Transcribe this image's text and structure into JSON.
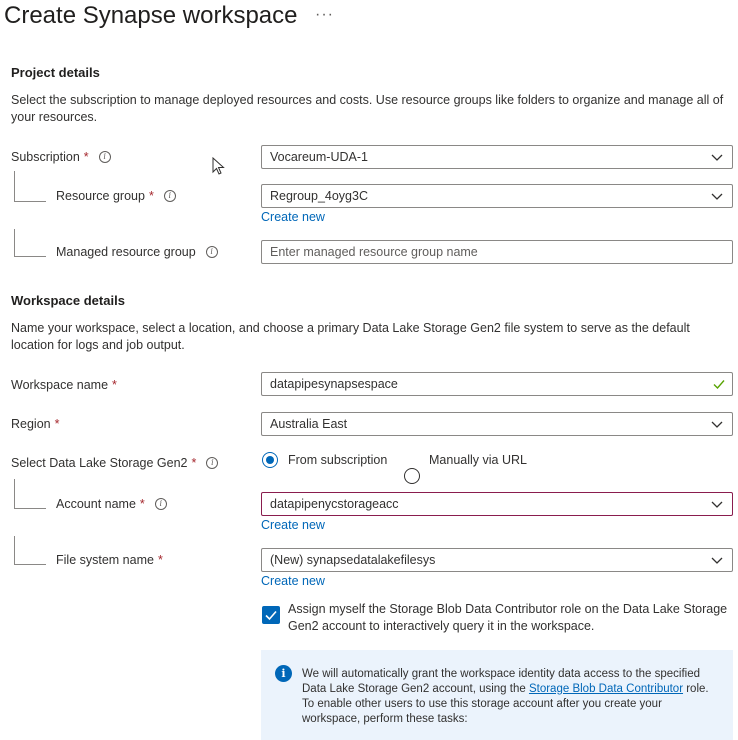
{
  "page": {
    "title": "Create Synapse workspace",
    "more_icon": "ellipsis-icon"
  },
  "project": {
    "heading": "Project details",
    "description": "Select the subscription to manage deployed resources and costs. Use resource groups like folders to organize and manage all of your resources.",
    "subscription": {
      "label": "Subscription",
      "value": "Vocareum-UDA-1"
    },
    "resource_group": {
      "label": "Resource group",
      "value": "Regroup_4oyg3C",
      "create_new": "Create new"
    },
    "managed_rg": {
      "label": "Managed resource group",
      "placeholder": "Enter managed resource group name"
    }
  },
  "workspace": {
    "heading": "Workspace details",
    "description": "Name your workspace, select a location, and choose a primary Data Lake Storage Gen2 file system to serve as the default location for logs and job output.",
    "name": {
      "label": "Workspace name",
      "value": "datapipesynapsespace"
    },
    "region": {
      "label": "Region",
      "value": "Australia East"
    },
    "datalake": {
      "label": "Select Data Lake Storage Gen2",
      "option1": "From subscription",
      "option2": "Manually via URL"
    },
    "account": {
      "label": "Account name",
      "value": "datapipenycstorageacc",
      "create_new": "Create new"
    },
    "filesystem": {
      "label": "File system name",
      "value": "(New) synapsedatalakefilesys",
      "create_new": "Create new"
    },
    "assign_role": "Assign myself the Storage Blob Data Contributor role on the Data Lake Storage Gen2 account to interactively query it in the workspace."
  },
  "info": {
    "text_before": "We will automatically grant the workspace identity data access to the specified Data Lake Storage Gen2 account, using the ",
    "link": "Storage Blob Data Contributor",
    "text_after": " role. To enable other users to use this storage account after you create your workspace, perform these tasks:"
  },
  "required_marker": "*",
  "colors": {
    "accent": "#0067b8",
    "required": "#a4262c",
    "focus_border": "#8a1d4e",
    "valid_check": "#57a300"
  }
}
